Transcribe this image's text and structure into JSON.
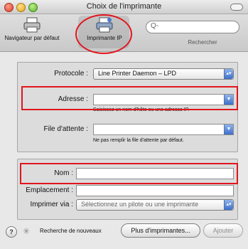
{
  "window": {
    "title": "Choix de l'imprimante"
  },
  "toolbar": {
    "default_browser_label": "Navigateur par défaut",
    "ip_printer_label": "Imprimante IP",
    "search_placeholder": "Q-",
    "search_label": "Rechercher"
  },
  "form": {
    "protocol_label": "Protocole :",
    "protocol_value": "Line Printer Daemon – LPD",
    "address_label": "Adresse :",
    "address_value": "",
    "address_hint": "Saisissez un nom d'hôte ou une adresse IP.",
    "queue_label": "File d'attente :",
    "queue_value": "",
    "queue_hint": "Ne pas remplir la file d'attente par défaut.",
    "name_label": "Nom :",
    "name_value": "",
    "location_label": "Emplacement :",
    "location_value": "",
    "print_via_label": "Imprimer via :",
    "print_via_value": "Sélectionnez un pilote ou une imprimante"
  },
  "footer": {
    "help_glyph": "?",
    "search_new_label": "Recherche de nouveaux",
    "more_printers_label": "Plus d'imprimantes...",
    "add_label": "Ajouter"
  },
  "colors": {
    "highlight": "#e0161e",
    "accent": "#3d6fcc"
  }
}
